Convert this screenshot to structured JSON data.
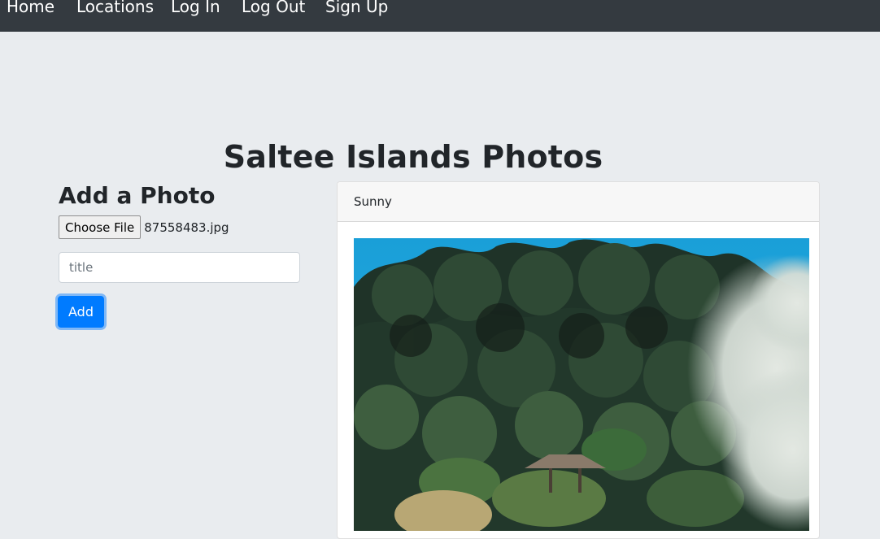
{
  "nav": {
    "items": [
      {
        "label": "Home"
      },
      {
        "label": "Locations"
      },
      {
        "label": "Log In"
      },
      {
        "label": "Log Out"
      },
      {
        "label": "Sign Up"
      }
    ]
  },
  "page": {
    "title": "Saltee Islands Photos"
  },
  "add_photo": {
    "heading": "Add a Photo",
    "file_button_label": "Choose File",
    "file_name": "87558483.jpg",
    "title_placeholder": "title",
    "title_value": "",
    "submit_label": "Add"
  },
  "photos": [
    {
      "title": "Sunny",
      "image_description": "garden with trees, shrubs, pagoda roof and steam"
    }
  ],
  "colors": {
    "navbar": "#343a40",
    "background": "#e9ecef",
    "primary": "#007bff"
  }
}
